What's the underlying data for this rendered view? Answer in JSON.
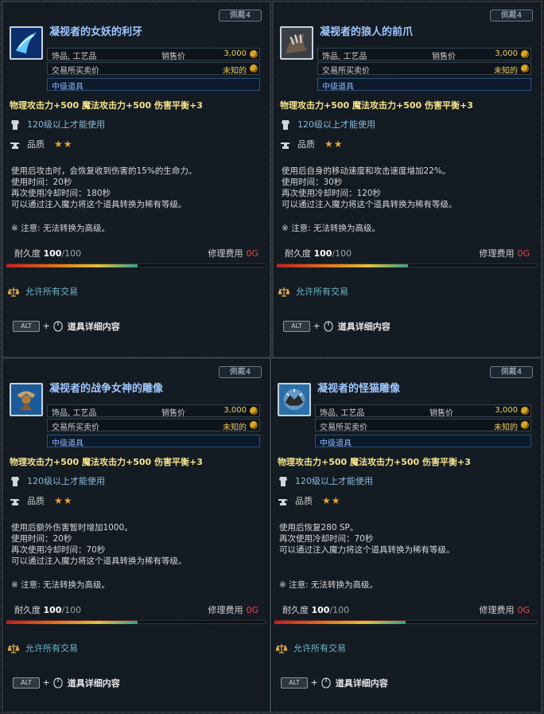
{
  "cards": [
    {
      "collect": "佩戴4",
      "name": "凝视者的女妖的利牙",
      "type": "饰品, 工艺品",
      "sell_label": "销售价",
      "sell_price": "3,000",
      "exchange_label": "交易所买卖价",
      "exchange_price": "未知的",
      "grade": "中级道具",
      "stats": "物理攻击力+500  魔法攻击力+500  伤害平衡+3",
      "requirement": "120级以上才能使用",
      "quality_label": "品质",
      "stars": "★★",
      "description": "使用后攻击时，会恢复收到伤害的15%的生命力。\n使用时间：20秒\n再次使用冷却时间：180秒\n可以通过注入魔力将这个道具转换为稀有等级。",
      "note": "※ 注意: 无法转换为高级。",
      "durability_label": "耐久度",
      "durability_cur": "100",
      "durability_max": "/100",
      "repair_label": "修理费用",
      "repair_cost": "0G",
      "trade": "允许所有交易",
      "alt_key": "ALT",
      "alt_plus": "+",
      "alt_label": "道具详细内容",
      "icon": "fang-icon"
    },
    {
      "collect": "佩戴4",
      "name": "凝视者的狼人的前爪",
      "type": "饰品, 工艺品",
      "sell_label": "销售价",
      "sell_price": "3,000",
      "exchange_label": "交易所买卖价",
      "exchange_price": "未知的",
      "grade": "中级道具",
      "stats": "物理攻击力+500  魔法攻击力+500  伤害平衡+3",
      "requirement": "120级以上才能使用",
      "quality_label": "品质",
      "stars": "★★",
      "description": "使用后自身的移动速度和攻击速度增加22%。\n使用时间：30秒\n再次使用冷却时间：120秒\n可以通过注入魔力将这个道具转换为稀有等级。",
      "note": "※ 注意: 无法转换为高级。",
      "durability_label": "耐久度",
      "durability_cur": "100",
      "durability_max": "/100",
      "repair_label": "修理费用",
      "repair_cost": "0G",
      "trade": "允许所有交易",
      "alt_key": "ALT",
      "alt_plus": "+",
      "alt_label": "道具详细内容",
      "icon": "claw-icon"
    },
    {
      "collect": "佩戴4",
      "name": "凝视者的战争女神的雕像",
      "type": "饰品, 工艺品",
      "sell_label": "销售价",
      "sell_price": "3,000",
      "exchange_label": "交易所买卖价",
      "exchange_price": "未知的",
      "grade": "中级道具",
      "stats": "物理攻击力+500  魔法攻击力+500  伤害平衡+3",
      "requirement": "120级以上才能使用",
      "quality_label": "品质",
      "stars": "★★",
      "description": "使用后额外伤害暂时增加1000。\n使用时间：20秒\n再次使用冷却时间：70秒\n可以通过注入魔力将这个道具转换为稀有等级。",
      "note": "※ 注意: 无法转换为高级。",
      "durability_label": "耐久度",
      "durability_cur": "100",
      "durability_max": "/100",
      "repair_label": "修理费用",
      "repair_cost": "0G",
      "trade": "允许所有交易",
      "alt_key": "ALT",
      "alt_plus": "+",
      "alt_label": "道具详细内容",
      "icon": "statue-icon"
    },
    {
      "collect": "佩戴4",
      "name": "凝视者的怪猫雕像",
      "type": "饰品, 工艺品",
      "sell_label": "销售价",
      "sell_price": "3,000",
      "exchange_label": "交易所买卖价",
      "exchange_price": "未知的",
      "grade": "中级道具",
      "stats": "物理攻击力+500  魔法攻击力+500  伤害平衡+3",
      "requirement": "120级以上才能使用",
      "quality_label": "品质",
      "stars": "★★",
      "description": "使用后恢复280 SP。\n再次使用冷却时间：70秒\n可以通过注入魔力将这个道具转换为稀有等级。",
      "note": "※ 注意: 无法转换为高级。",
      "durability_label": "耐久度",
      "durability_cur": "100",
      "durability_max": "/100",
      "repair_label": "修理费用",
      "repair_cost": "0G",
      "trade": "允许所有交易",
      "alt_key": "ALT",
      "alt_plus": "+",
      "alt_label": "道具详细内容",
      "icon": "cat-statue-icon"
    }
  ]
}
